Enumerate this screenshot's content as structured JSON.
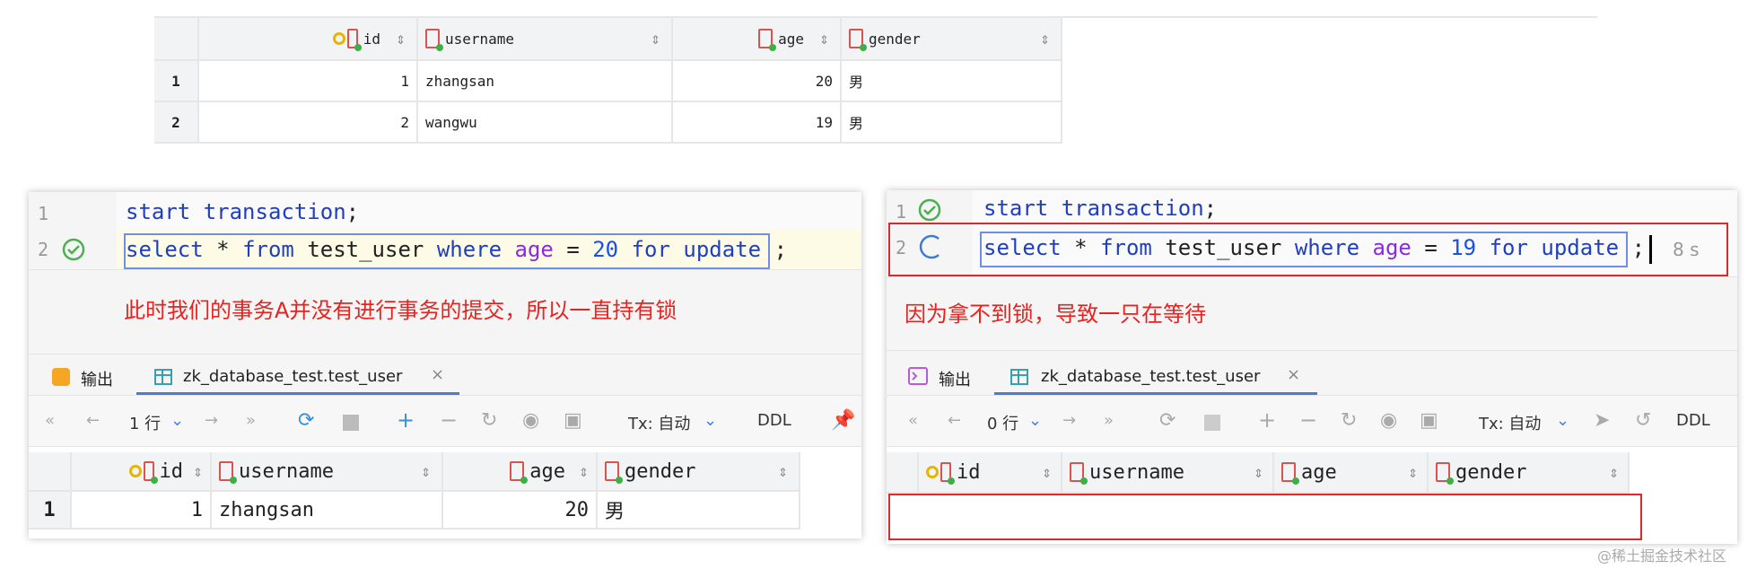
{
  "top_table": {
    "columns": [
      "id",
      "username",
      "age",
      "gender"
    ],
    "rows": [
      {
        "n": "1",
        "id": "1",
        "username": "zhangsan",
        "age": "20",
        "gender": "男"
      },
      {
        "n": "2",
        "id": "2",
        "username": "wangwu",
        "age": "19",
        "gender": "男"
      }
    ]
  },
  "left": {
    "lines": [
      "1",
      "2"
    ],
    "code1": {
      "kw1": "start",
      "kw2": "transaction",
      "end": ";"
    },
    "code2": {
      "select": "select",
      "star": "*",
      "from": "from",
      "table": "test_user",
      "where": "where",
      "col": "age",
      "eq": "=",
      "val": "20",
      "for": "for",
      "update": "update",
      "end": ";"
    },
    "annotation": "此时我们的事务A并没有进行事务的提交，所以一直持有锁",
    "tabs": {
      "output": "输出",
      "table": "zk_database_test.test_user",
      "close": "×"
    },
    "toolbar": {
      "rows": "1 行",
      "tx": "Tx: 自动",
      "ddl": "DDL"
    },
    "result": {
      "columns": [
        "id",
        "username",
        "age",
        "gender"
      ],
      "rows": [
        {
          "n": "1",
          "id": "1",
          "username": "zhangsan",
          "age": "20",
          "gender": "男"
        }
      ]
    }
  },
  "right": {
    "lines": [
      "1",
      "2"
    ],
    "code1": {
      "kw1": "start",
      "kw2": "transaction",
      "end": ";"
    },
    "code2": {
      "select": "select",
      "star": "*",
      "from": "from",
      "table": "test_user",
      "where": "where",
      "col": "age",
      "eq": "=",
      "val": "19",
      "for": "for",
      "update": "update",
      "end": ";"
    },
    "elapsed": "8 s",
    "annotation": "因为拿不到锁，导致一只在等待",
    "tabs": {
      "output": "输出",
      "table": "zk_database_test.test_user",
      "close": "×"
    },
    "toolbar": {
      "rows": "0 行",
      "tx": "Tx: 自动",
      "ddl": "DDL"
    },
    "result": {
      "columns": [
        "id",
        "username",
        "age",
        "gender"
      ]
    }
  },
  "watermark": "@稀土掘金技术社区",
  "colors": {
    "annotation": "#e8221e",
    "keyword": "#1f3fbf",
    "column": "#8a2be2",
    "number": "#1750eb",
    "redbox": "#e0282a"
  }
}
